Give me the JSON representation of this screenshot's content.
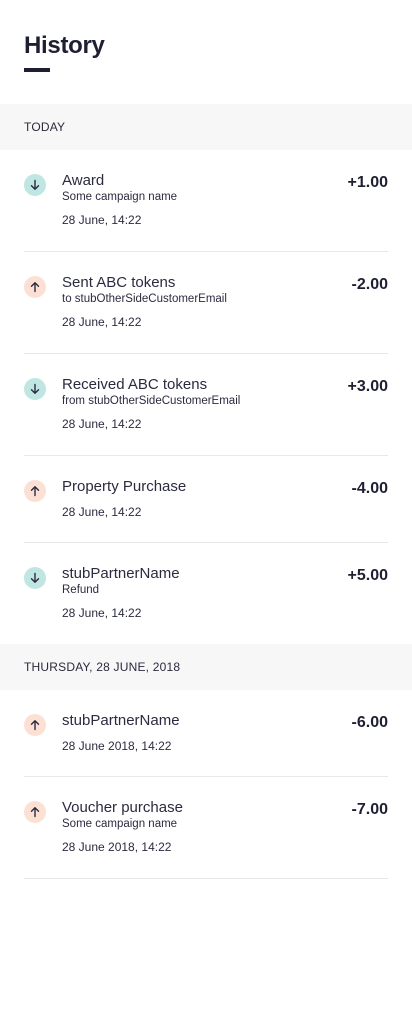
{
  "header": {
    "title": "History"
  },
  "sections": [
    {
      "label": "TODAY"
    },
    {
      "label": "THURSDAY, 28 JUNE, 2018"
    }
  ],
  "transactions": [
    {
      "direction": "in",
      "title": "Award",
      "subtitle": "Some campaign name",
      "date": "28 June, 14:22",
      "amount": "+1.00"
    },
    {
      "direction": "out",
      "title": "Sent ABC tokens",
      "subtitle": "to stubOtherSideCustomerEmail",
      "date": "28 June, 14:22",
      "amount": "-2.00"
    },
    {
      "direction": "in",
      "title": "Received ABC tokens",
      "subtitle": "from stubOtherSideCustomerEmail",
      "date": "28 June, 14:22",
      "amount": "+3.00"
    },
    {
      "direction": "out",
      "title": "Property Purchase",
      "subtitle": "",
      "date": "28 June, 14:22",
      "amount": "-4.00"
    },
    {
      "direction": "in",
      "title": "stubPartnerName",
      "subtitle": "Refund",
      "date": "28 June, 14:22",
      "amount": "+5.00"
    },
    {
      "direction": "out",
      "title": "stubPartnerName",
      "subtitle": "",
      "date": "28 June 2018, 14:22",
      "amount": "-6.00"
    },
    {
      "direction": "out",
      "title": "Voucher purchase",
      "subtitle": "Some campaign name",
      "date": "28 June 2018, 14:22",
      "amount": "-7.00"
    }
  ],
  "icons": {
    "in": "arrow-down-icon",
    "out": "arrow-up-icon"
  },
  "colors": {
    "in_bg": "#bfe6e2",
    "out_bg": "#fde0d4",
    "text": "#1f1f33"
  }
}
